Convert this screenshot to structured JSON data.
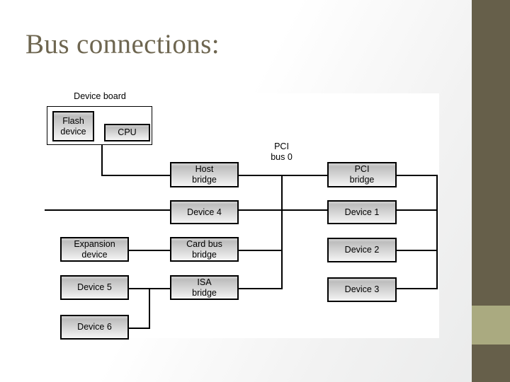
{
  "slide": {
    "title": "Bus connections:",
    "title_color": "#6e6650",
    "accent_dark": "#665f4a",
    "accent_light": "#aaaa80",
    "background": "#ffffff"
  },
  "diagram": {
    "type": "block-diagram",
    "group_label": "Device board",
    "bus_label": "PCI\nbus 0",
    "nodes": [
      {
        "id": "flash",
        "label": "Flash\ndevice"
      },
      {
        "id": "cpu",
        "label": "CPU"
      },
      {
        "id": "host",
        "label": "Host\nbridge"
      },
      {
        "id": "pci",
        "label": "PCI\nbridge"
      },
      {
        "id": "device4",
        "label": "Device 4"
      },
      {
        "id": "device1",
        "label": "Device 1"
      },
      {
        "id": "expansion",
        "label": "Expansion\ndevice"
      },
      {
        "id": "cardbus",
        "label": "Card bus\nbridge"
      },
      {
        "id": "device2",
        "label": "Device 2"
      },
      {
        "id": "device5",
        "label": "Device 5"
      },
      {
        "id": "isa",
        "label": "ISA\nbridge"
      },
      {
        "id": "device3",
        "label": "Device 3"
      },
      {
        "id": "device6",
        "label": "Device 6"
      }
    ]
  }
}
